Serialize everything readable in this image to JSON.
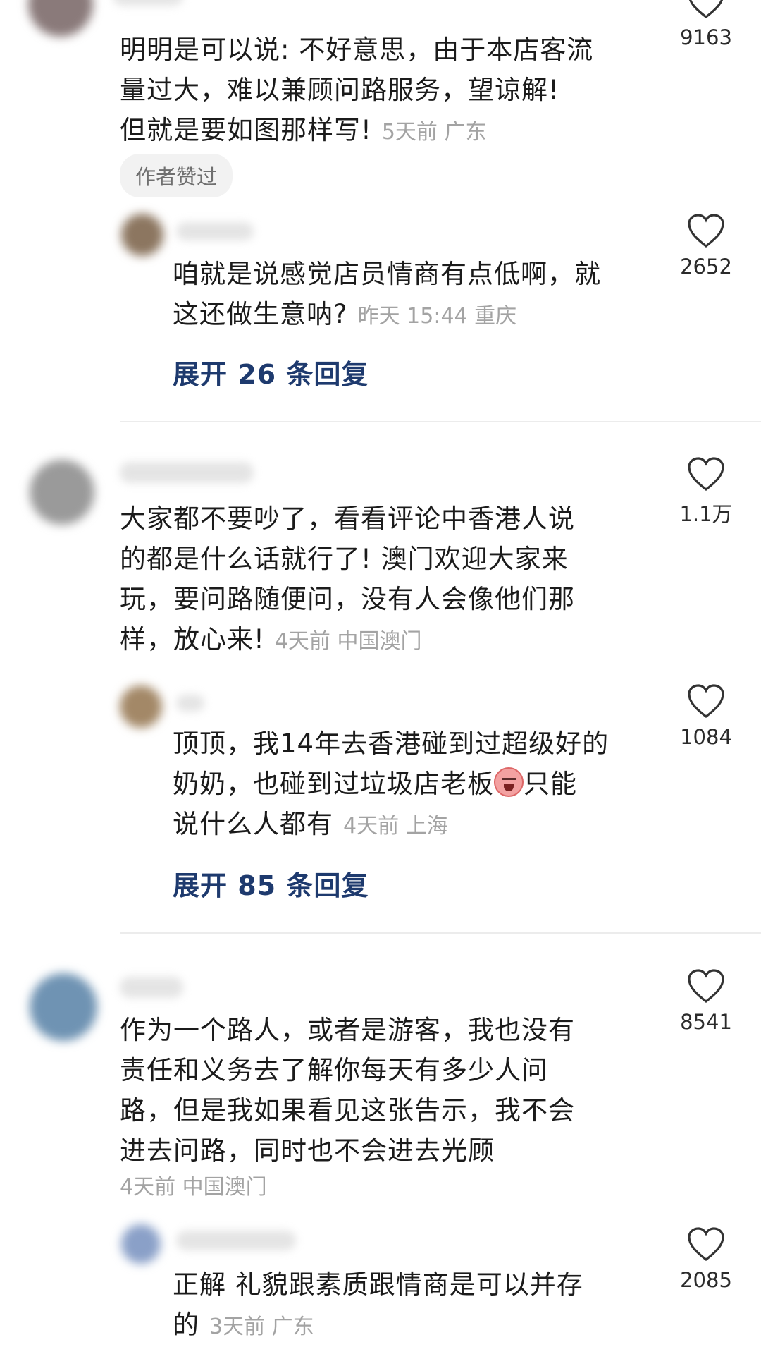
{
  "comments": [
    {
      "text": "明明是可以说: 不好意思，由于本店客流量过大，难以兼顾问路服务，望谅解! 但就是要如图那样写!",
      "line1": "明明是可以说: 不好意思，由于本店客流",
      "line2": "量过大，难以兼顾问路服务，望谅解!",
      "line3": "但就是要如图那样写!",
      "meta": "5天前 广东",
      "badge": "作者赞过",
      "likes": "9163"
    },
    {
      "line1": "咱就是说感觉店员情商有点低啊，就",
      "line2": "这还做生意呐?",
      "meta": "昨天 15:44 重庆",
      "likes": "2652",
      "expand": "展开 26 条回复"
    },
    {
      "line1": "大家都不要吵了，看看评论中香港人说",
      "line2": "的都是什么话就行了! 澳门欢迎大家来",
      "line3": "玩，要问路随便问，没有人会像他们那",
      "line4": "样，放心来!",
      "meta": "4天前 中国澳门",
      "likes": "1.1万"
    },
    {
      "line1": "顶顶，我14年去香港碰到过超级好的",
      "line2a": "奶奶，也碰到过垃圾店老板",
      "line2b": "只能",
      "line3": "说什么人都有",
      "meta": "4天前 上海",
      "likes": "1084",
      "expand": "展开 85 条回复"
    },
    {
      "line1": "作为一个路人，或者是游客，我也没有",
      "line2": "责任和义务去了解你每天有多少人问",
      "line3": "路，但是我如果看见这张告示，我不会",
      "line4": "进去问路，同时也不会进去光顾",
      "meta": "4天前 中国澳门",
      "likes": "8541"
    },
    {
      "line1": "正解 礼貌跟素质跟情商是可以并存",
      "line2": "的",
      "meta": "3天前 广东",
      "likes": "2085"
    }
  ],
  "colors": {
    "expand": "#1e3a6e",
    "meta": "#a3a3a3",
    "divider": "#ececec"
  },
  "icons": {
    "like": "heart-outline-icon",
    "reaction": "crying-face-emoji"
  }
}
